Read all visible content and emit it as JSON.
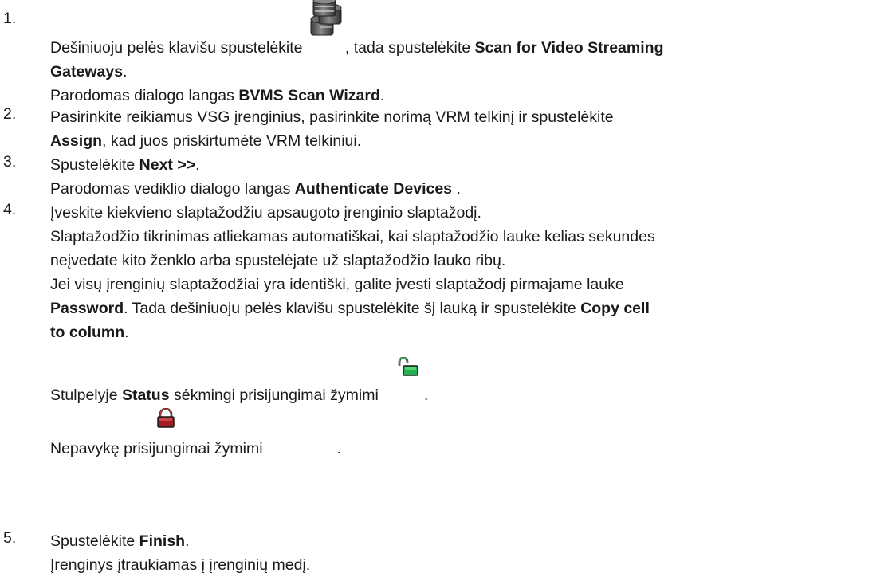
{
  "steps": [
    {
      "number": "1.",
      "lines": [
        {
          "before_icon": "Dešiniuoju pelės klavišu spustelėkite ",
          "after_icon": ", tada spustelėkite ",
          "bold": "Scan for Video Streaming"
        },
        {
          "bold": "Gateways",
          "tail": "."
        },
        {
          "text": "Parodomas dialogo langas ",
          "bold": "BVMS Scan Wizard",
          "tail": "."
        }
      ],
      "icon": "server-database-icon"
    },
    {
      "number": "2.",
      "lines": [
        {
          "text": "Pasirinkite reikiamus VSG įrenginius, pasirinkite norimą VRM telkinį ir spustelėkite"
        },
        {
          "bold": "Assign",
          "tail": ", kad juos priskirtumėte VRM telkiniui."
        }
      ]
    },
    {
      "number": "3.",
      "lines": [
        {
          "text": "Spustelėkite ",
          "bold": "Next >>",
          "tail": "."
        },
        {
          "text": "Parodomas vediklio dialogo langas ",
          "bold": "Authenticate Devices",
          "tail": " ."
        }
      ]
    },
    {
      "number": "4.",
      "lines": [
        {
          "text": "Įveskite kiekvieno slaptažodžiu apsaugoto įrenginio slaptažodį."
        },
        {
          "text": "Slaptažodžio tikrinimas atliekamas automatiškai, kai slaptažodžio lauke kelias sekundes"
        },
        {
          "text": "neįvedate kito ženklo arba spustelėjate už slaptažodžio lauko ribų."
        },
        {
          "text": "Jei visų įrenginių slaptažodžiai yra identiški, galite įvesti slaptažodį pirmajame lauke"
        },
        {
          "bold": "Password",
          "tail": ". Tada dešiniuoju pelės klavišu spustelėkite šį lauką ir spustelėkite ",
          "bold2": "Copy cell"
        },
        {
          "bold": "to column",
          "tail": "."
        },
        {
          "text": "Stulpelyje ",
          "bold": "Status",
          "tail": " sėkmingi prisijungimai žymimi",
          "end": "."
        },
        {
          "text": "Nepavykę prisijungimai žymimi",
          "end": "."
        }
      ],
      "success_icon": "unlocked-padlock-green-icon",
      "fail_icon": "locked-padlock-red-icon",
      "colors": {
        "success": "#22b14c",
        "fail": "#a01c20"
      }
    },
    {
      "number": "5.",
      "lines": [
        {
          "text": "Spustelėkite ",
          "bold": "Finish",
          "tail": "."
        },
        {
          "text": "Įrenginys įtraukiamas į įrenginių medį."
        }
      ]
    }
  ]
}
